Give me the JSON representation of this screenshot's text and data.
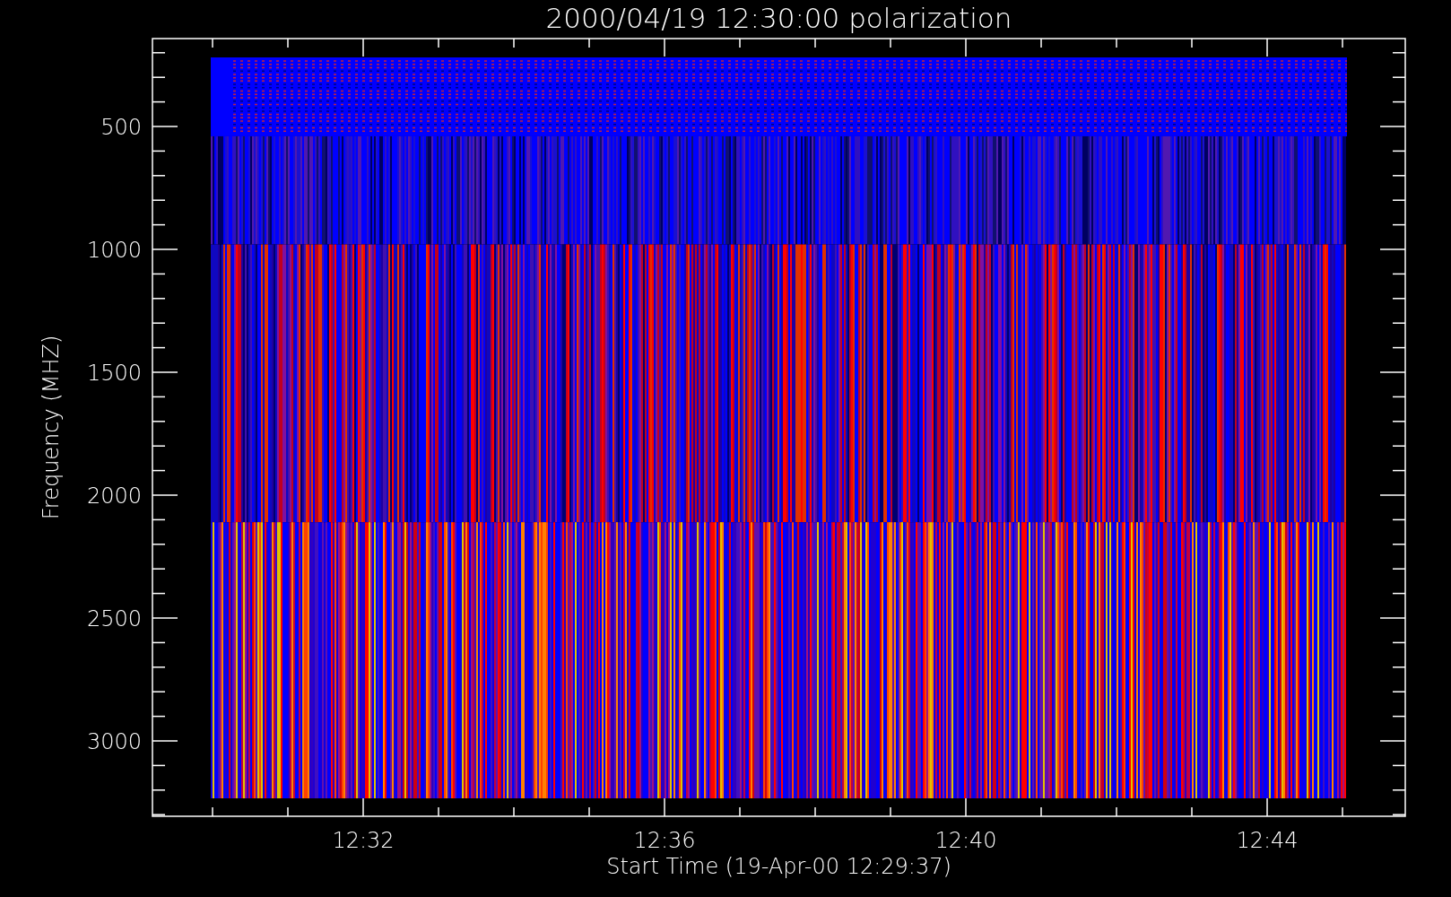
{
  "plot": {
    "title": "2000/04/19 12:30:00 polarization",
    "y_axis": {
      "label": "Frequency (MHZ)",
      "ticks": [
        "500",
        "1000",
        "1500",
        "2000",
        "2500",
        "3000"
      ]
    },
    "x_axis": {
      "label": "Start Time (19-Apr-00 12:29:37)",
      "ticks": [
        "12:32",
        "12:36",
        "12:40",
        "12:44"
      ]
    }
  }
}
